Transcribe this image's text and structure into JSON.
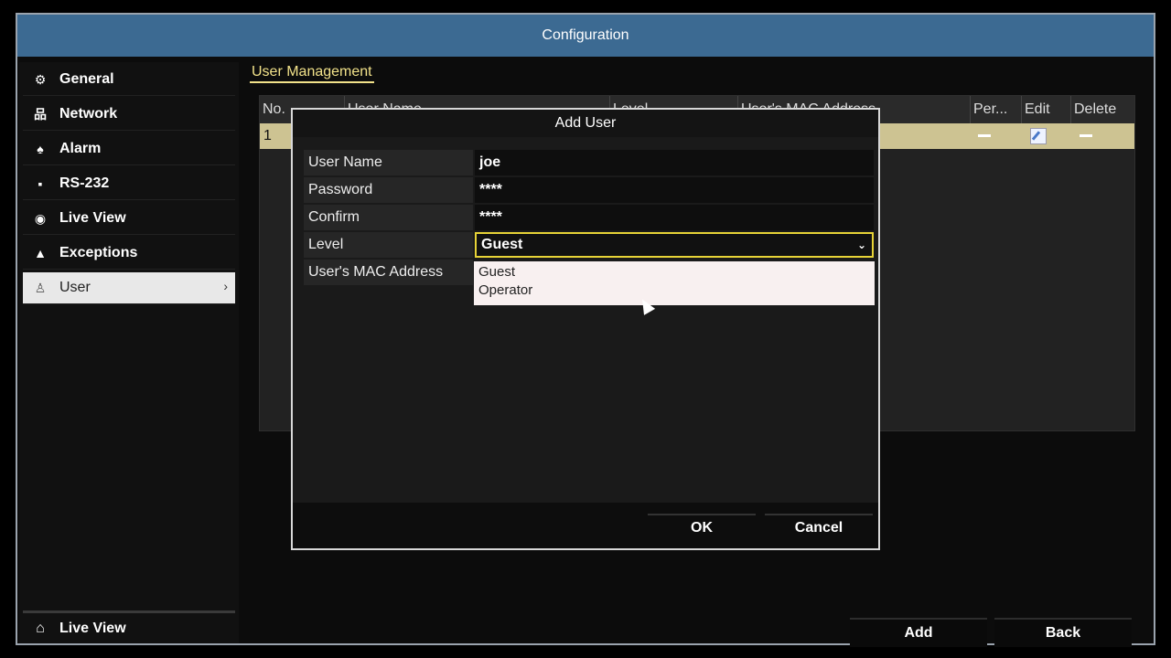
{
  "window": {
    "title": "Configuration"
  },
  "sidebar": {
    "items": [
      {
        "label": "General",
        "icon": "gear-icon"
      },
      {
        "label": "Network",
        "icon": "network-icon"
      },
      {
        "label": "Alarm",
        "icon": "alarm-icon"
      },
      {
        "label": "RS-232",
        "icon": "rs232-icon"
      },
      {
        "label": "Live View",
        "icon": "eye-icon"
      },
      {
        "label": "Exceptions",
        "icon": "warning-icon"
      },
      {
        "label": "User",
        "icon": "user-icon",
        "active": true
      }
    ],
    "bottom": {
      "label": "Live View",
      "icon": "home-icon"
    }
  },
  "main": {
    "section_title": "User Management",
    "table": {
      "headers": [
        "No.",
        "User Name",
        "Level",
        "User's MAC Address",
        "Per...",
        "Edit",
        "Delete"
      ],
      "rows": [
        {
          "no": "1"
        }
      ]
    },
    "buttons": {
      "add": "Add",
      "back": "Back"
    }
  },
  "dialog": {
    "title": "Add User",
    "fields": {
      "user_name_label": "User Name",
      "user_name_value": "joe",
      "password_label": "Password",
      "password_value": "****",
      "confirm_label": "Confirm",
      "confirm_value": "****",
      "level_label": "Level",
      "level_value": "Guest",
      "mac_label": "User's MAC Address"
    },
    "level_options": [
      "Guest",
      "Operator"
    ],
    "buttons": {
      "ok": "OK",
      "cancel": "Cancel"
    }
  },
  "colors": {
    "titlebar": "#3c6a92",
    "accent": "#f2e28a",
    "selected_row": "#cdc392",
    "select_border": "#e7d337"
  }
}
